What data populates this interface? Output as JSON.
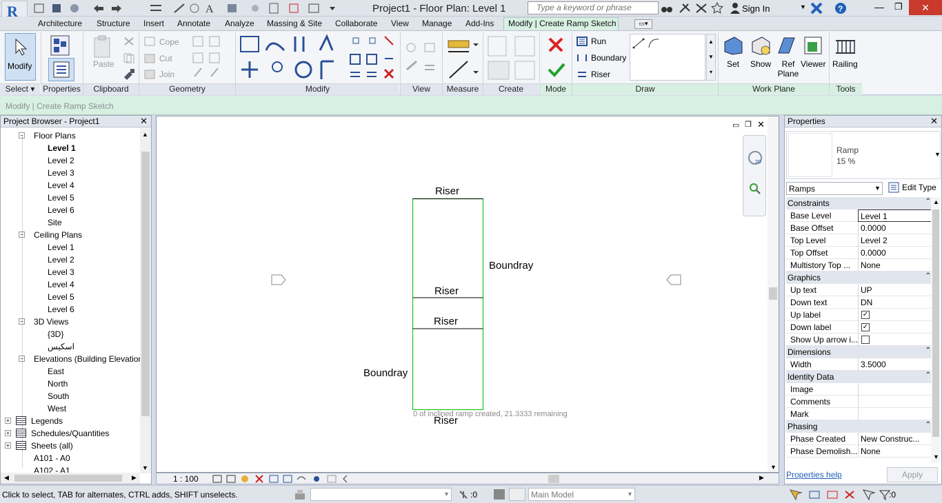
{
  "app": {
    "title": "Project1 - Floor Plan: Level 1",
    "logo": "R",
    "logo_sub": "A"
  },
  "titlebar": {
    "search_placeholder": "Type a keyword or phrase",
    "sign_in": "Sign In"
  },
  "tabs": [
    "Architecture",
    "Structure",
    "Insert",
    "Annotate",
    "Analyze",
    "Massing & Site",
    "Collaborate",
    "View",
    "Manage",
    "Add-Ins",
    "Modify | Create Ramp Sketch"
  ],
  "ribbon": {
    "modify": "Modify",
    "select": "Select",
    "properties": "Properties",
    "clipboard": "Clipboard",
    "paste": "Paste",
    "geometry": "Geometry",
    "cope": "Cope",
    "cut": "Cut",
    "join": "Join",
    "modify_panel": "Modify",
    "view": "View",
    "measure": "Measure",
    "create": "Create",
    "mode": "Mode",
    "run": "Run",
    "boundary": "Boundary",
    "riser": "Riser",
    "draw": "Draw",
    "set": "Set",
    "show": "Show",
    "ref_plane": "Ref Plane",
    "viewer": "Viewer",
    "work_plane": "Work Plane",
    "railing": "Railing",
    "tools": "Tools"
  },
  "optbar": {
    "context": "Modify | Create Ramp Sketch"
  },
  "browser": {
    "title": "Project Browser - Project1",
    "items": [
      {
        "label": "Floor Plans",
        "level": 1
      },
      {
        "label": "Level 1",
        "level": 2
      },
      {
        "label": "Level 2",
        "level": 2
      },
      {
        "label": "Level 3",
        "level": 2
      },
      {
        "label": "Level 4",
        "level": 2
      },
      {
        "label": "Level 5",
        "level": 2
      },
      {
        "label": "Level 6",
        "level": 2
      },
      {
        "label": "Site",
        "level": 2
      },
      {
        "label": "Ceiling Plans",
        "level": 1
      },
      {
        "label": "Level 1",
        "level": 2
      },
      {
        "label": "Level 2",
        "level": 2
      },
      {
        "label": "Level 3",
        "level": 2
      },
      {
        "label": "Level 4",
        "level": 2
      },
      {
        "label": "Level 5",
        "level": 2
      },
      {
        "label": "Level 6",
        "level": 2
      },
      {
        "label": "3D Views",
        "level": 1
      },
      {
        "label": "{3D}",
        "level": 2
      },
      {
        "label": "اسکیس",
        "level": 2
      },
      {
        "label": "Elevations (Building Elevation",
        "level": 1
      },
      {
        "label": "East",
        "level": 2
      },
      {
        "label": "North",
        "level": 2
      },
      {
        "label": "South",
        "level": 2
      },
      {
        "label": "West",
        "level": 2
      },
      {
        "label": "Legends",
        "level": 0
      },
      {
        "label": "Schedules/Quantities",
        "level": 0
      },
      {
        "label": "Sheets (all)",
        "level": 0
      },
      {
        "label": "A101 - A0",
        "level": 1
      },
      {
        "label": "A102 - A1",
        "level": 1
      }
    ]
  },
  "canvas": {
    "riser_top": "Riser",
    "boundary_right": "Boundray",
    "riser_mid1": "Riser",
    "riser_mid2": "Riser",
    "boundary_left": "Boundray",
    "riser_bottom": "Riser",
    "hint": "0 of inclined ramp created, 21.3333 remaining"
  },
  "viewbar": {
    "scale": "1 : 100"
  },
  "properties": {
    "title": "Properties",
    "type_name": "Ramp",
    "type_sub": "15 %",
    "category": "Ramps",
    "edit_type": "Edit Type",
    "groups": [
      {
        "name": "Constraints",
        "rows": [
          {
            "key": "Base Level",
            "value": "Level 1"
          },
          {
            "key": "Base Offset",
            "value": "0.0000"
          },
          {
            "key": "Top Level",
            "value": "Level 2"
          },
          {
            "key": "Top Offset",
            "value": "0.0000"
          },
          {
            "key": "Multistory Top ...",
            "value": "None"
          }
        ]
      },
      {
        "name": "Graphics",
        "rows": [
          {
            "key": "Up text",
            "value": "UP"
          },
          {
            "key": "Down text",
            "value": "DN"
          },
          {
            "key": "Up label",
            "value": "",
            "check": true
          },
          {
            "key": "Down label",
            "value": "",
            "check": true
          },
          {
            "key": "Show Up arrow i...",
            "value": "",
            "check": false
          }
        ]
      },
      {
        "name": "Dimensions",
        "rows": [
          {
            "key": "Width",
            "value": "3.5000"
          }
        ]
      },
      {
        "name": "Identity Data",
        "rows": [
          {
            "key": "Image",
            "value": ""
          },
          {
            "key": "Comments",
            "value": ""
          },
          {
            "key": "Mark",
            "value": ""
          }
        ]
      },
      {
        "name": "Phasing",
        "rows": [
          {
            "key": "Phase Created",
            "value": "New Construc..."
          },
          {
            "key": "Phase Demolish...",
            "value": "None"
          }
        ]
      }
    ],
    "help": "Properties help",
    "apply": "Apply"
  },
  "status": {
    "message": "Click to select, TAB for alternates, CTRL adds, SHIFT unselects.",
    "count": ":0",
    "model": "Main Model",
    "filter_count": ":0"
  },
  "colors": {
    "accent": "#1f5fb8",
    "sketch_green": "#22c222",
    "context_tab": "#d8f0e3"
  }
}
